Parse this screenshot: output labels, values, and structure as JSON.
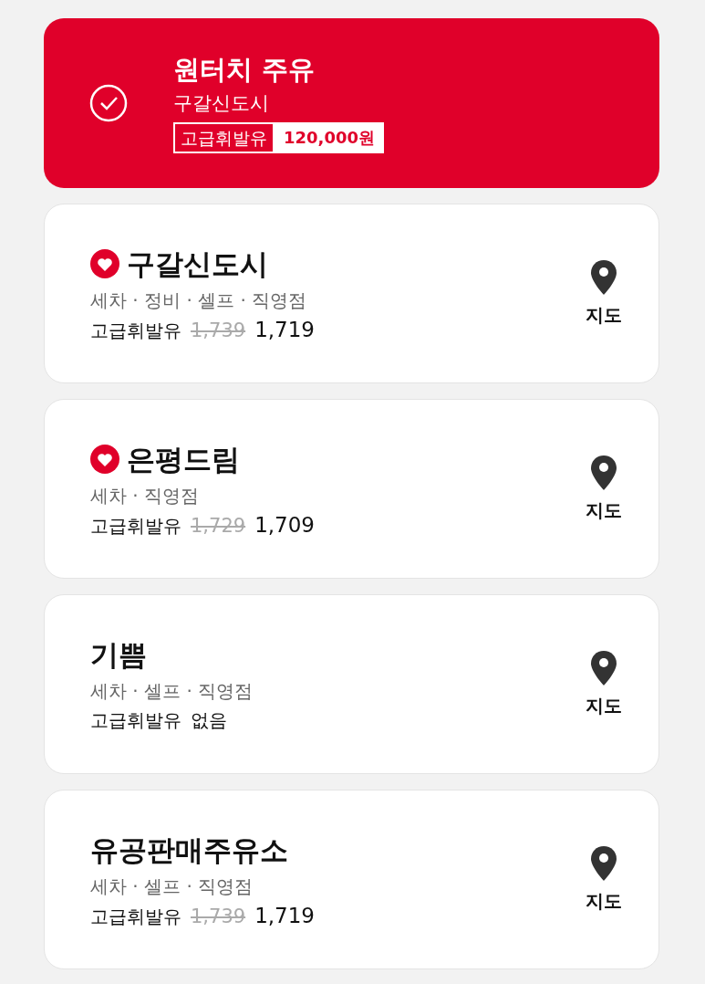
{
  "selected_station": {
    "title": "원터치 주유",
    "location": "구갈신도시",
    "fuel": "고급휘발유",
    "amount": "120,000원"
  },
  "stations": [
    {
      "name": "구갈신도시",
      "favorite": true,
      "features": "세차 · 정비 · 셀프 · 직영점",
      "fuel": "고급휘발유",
      "kind": "priced",
      "original_price": "1,739",
      "price": "1,719",
      "map_label": "지도"
    },
    {
      "name": "은평드림",
      "favorite": true,
      "features": "세차 · 직영점",
      "fuel": "고급휘발유",
      "kind": "priced",
      "original_price": "1,729",
      "price": "1,709",
      "map_label": "지도"
    },
    {
      "name": "기쁨",
      "favorite": false,
      "features": "세차 · 셀프 · 직영점",
      "fuel": "고급휘발유",
      "kind": "unavailable",
      "status": "없음",
      "map_label": "지도"
    },
    {
      "name": "유공판매주유소",
      "favorite": false,
      "features": "세차 · 셀프 · 직영점",
      "fuel": "고급휘발유",
      "kind": "priced",
      "original_price": "1,739",
      "price": "1,719",
      "map_label": "지도"
    }
  ]
}
